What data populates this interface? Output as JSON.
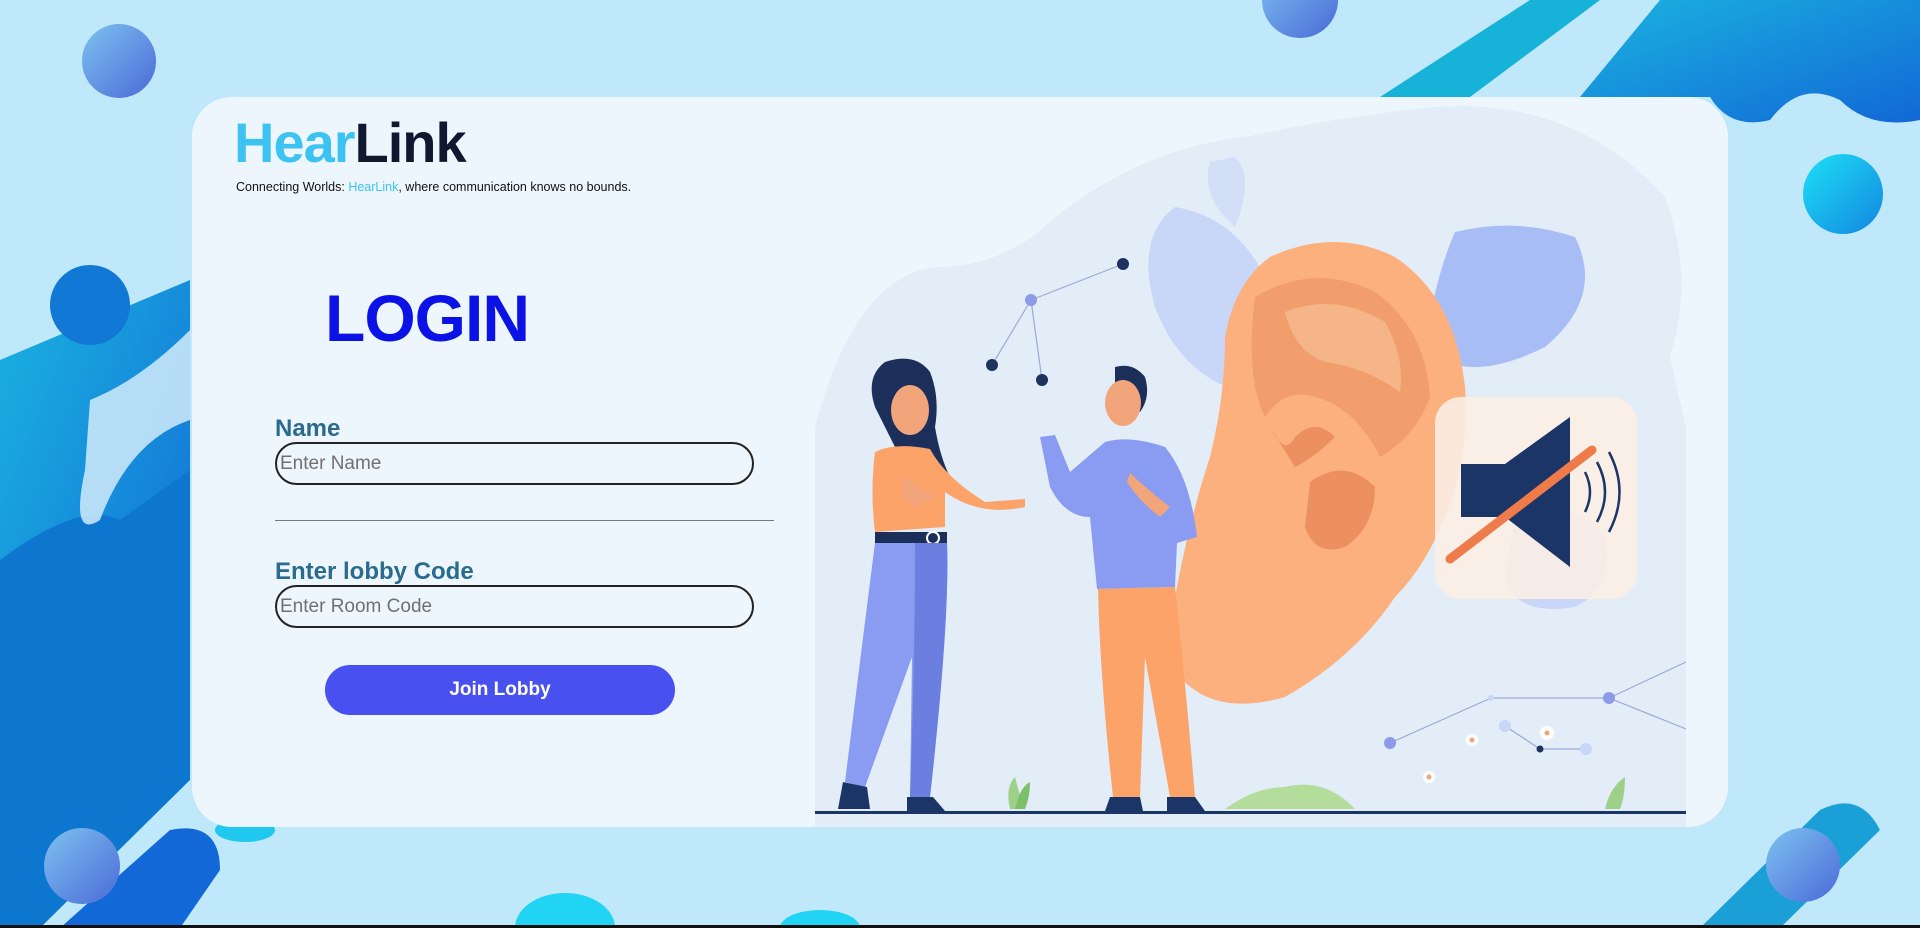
{
  "brand": {
    "name_part1": "Hear",
    "name_part2": "Link",
    "tagline_prefix": "Connecting Worlds: ",
    "tagline_highlight": "HearLink",
    "tagline_suffix": ", where communication knows no bounds.",
    "accent_color": "#3cc3f2",
    "dark_color": "#101830"
  },
  "login": {
    "title": "LOGIN",
    "title_color": "#0a12e6",
    "name_label": "Name",
    "name_placeholder": "Enter Name",
    "name_value": "",
    "code_label": "Enter lobby Code",
    "code_placeholder": "Enter Room Code",
    "code_value": "",
    "submit_label": "Join Lobby",
    "submit_color": "#4950f0"
  },
  "illustration": {
    "subject": "two people talking beside a large ear with a muted speaker",
    "icons": [
      "muted-speaker-icon",
      "ear-icon"
    ]
  }
}
